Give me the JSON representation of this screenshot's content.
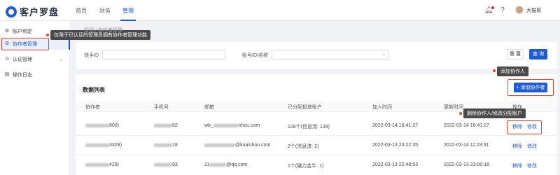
{
  "app": {
    "logo_text": "客户罗盘"
  },
  "nav": {
    "home": "首页",
    "finance": "财务",
    "manage": "管理"
  },
  "header": {
    "username": "大猫哥"
  },
  "sidebar": {
    "items": [
      {
        "label": "账户绑定",
        "icon": "gear-icon"
      },
      {
        "label": "协作者管理",
        "icon": "settings-icon"
      },
      {
        "label": "认证管理",
        "icon": "check-circle-icon"
      },
      {
        "label": "操作日志",
        "icon": "log-icon"
      }
    ]
  },
  "tooltips": {
    "permission": "仅限于已认证的管理员拥有协作者管理功能",
    "add": "添加协作人",
    "edit": "删除协作人/修改分配账户"
  },
  "breadcrumb": {
    "parent": "管理",
    "sep": "/",
    "current": "协作者管理"
  },
  "filter": {
    "id_label": "快手ID",
    "id_placeholder": "",
    "account_label": "账号ID/名称",
    "account_placeholder": "",
    "reset": "重 置",
    "search": "查 询"
  },
  "list": {
    "title": "数据列表",
    "add_button": "+ 添加协作者",
    "columns": [
      "协作者",
      "手机号",
      "邮箱",
      "已分配投放账户",
      "加入时间",
      "更新时间",
      "操作"
    ],
    "rows": [
      {
        "collab_suffix": "800)",
        "phone_suffix": "82",
        "email_prefix": "wb_",
        "email_suffix": "shou.com",
        "accounts": "128个(信息流: 128)",
        "joined": "2022-03-14 16:41:27",
        "updated": "2022-03-14 16:41:27",
        "remove": "移除",
        "modify": "修改"
      },
      {
        "collab_suffix": "3328)",
        "phone_suffix": "18",
        "email_prefix": "",
        "email_suffix": "@kuaishou.com",
        "accounts": "2个(信息流: 2)",
        "joined": "2022-03-13 23:22:35",
        "updated": "2022-03-14 11:23:31",
        "remove": "移除",
        "modify": "修改"
      },
      {
        "collab_suffix": "429)",
        "phone_suffix": "93",
        "email_prefix": "11",
        "email_suffix": "@qq.com",
        "accounts": "1个(磁力金牛: 1)",
        "joined": "2022-03-13 22:48:53",
        "updated": "2022-03-13 23:00:18",
        "remove": "移除",
        "modify": "修改"
      }
    ]
  },
  "colors": {
    "accent": "#1f5bd6",
    "highlight": "#e8432c"
  }
}
